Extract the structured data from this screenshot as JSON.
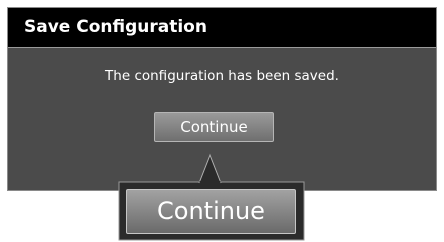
{
  "dialog": {
    "title": "Save Configuration",
    "message": "The configuration has been saved.",
    "continue_label": "Continue"
  },
  "callout": {
    "continue_label": "Continue"
  },
  "colors": {
    "title_bar": "#000000",
    "dialog_body": "#4b4b4b",
    "button": "#8a8a8a",
    "text": "#ffffff"
  }
}
